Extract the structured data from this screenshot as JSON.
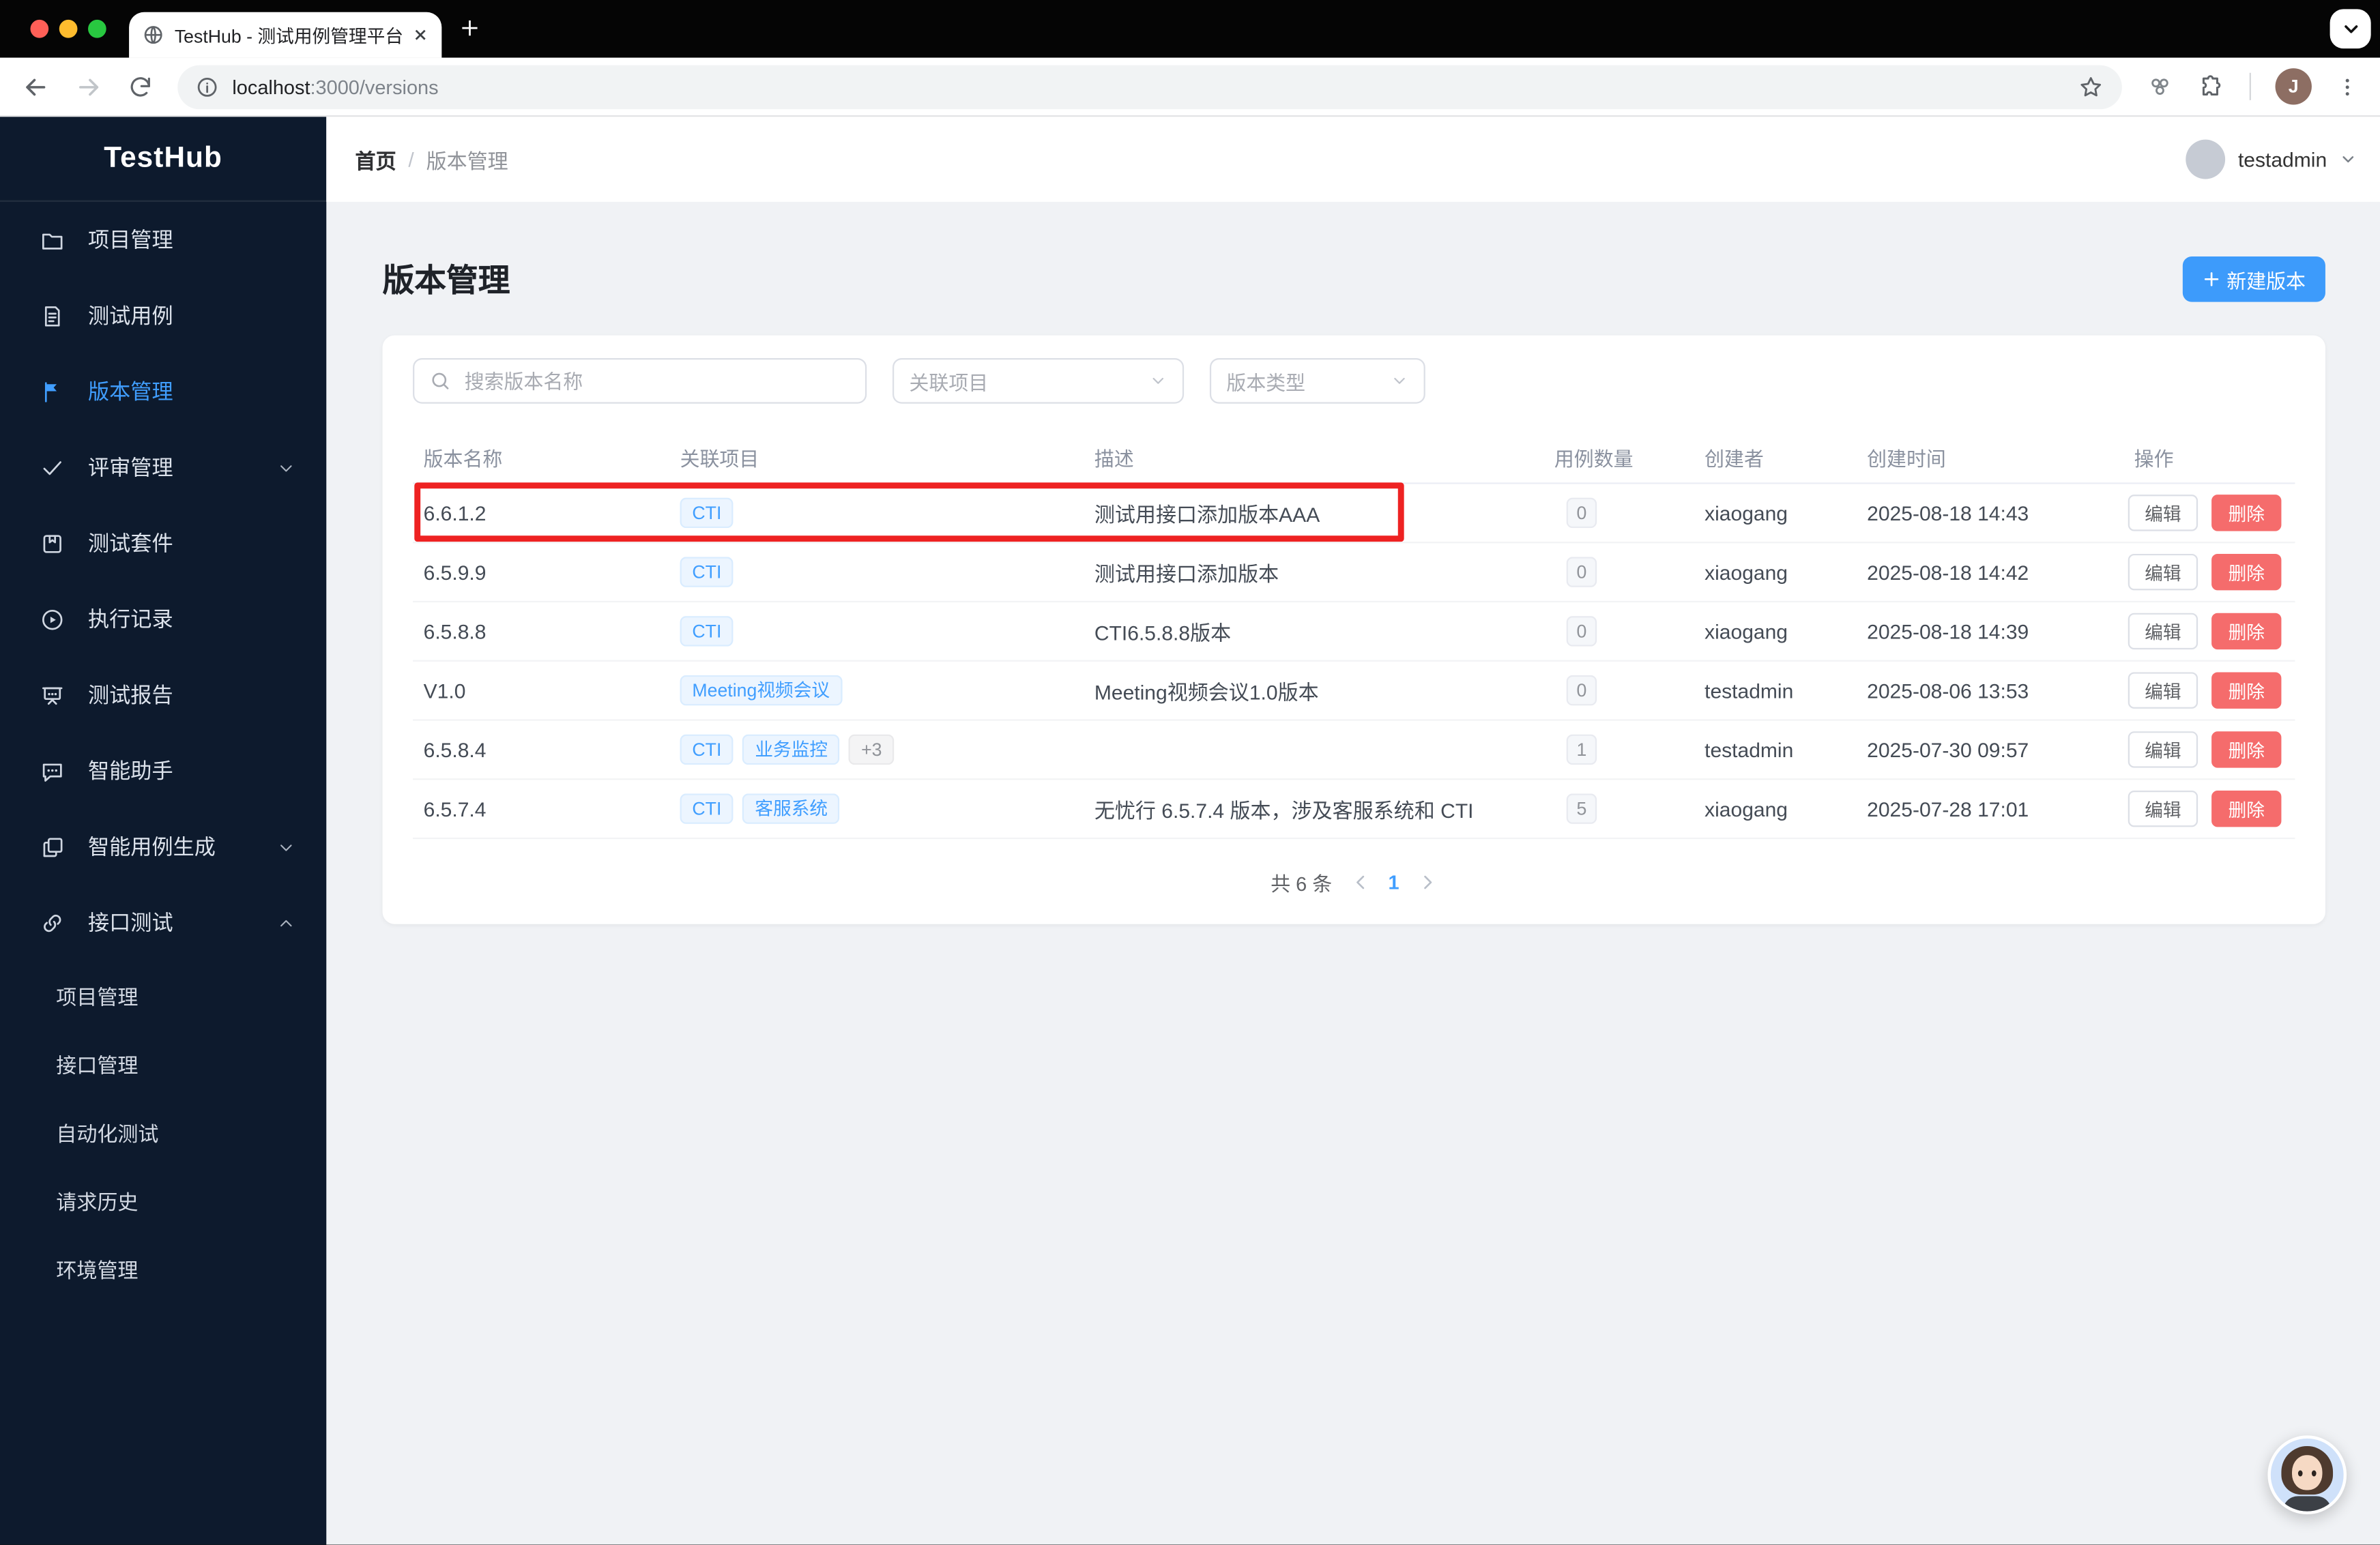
{
  "browser": {
    "tab_title": "TestHub - 测试用例管理平台",
    "url_host": "localhost",
    "url_rest": ":3000/versions"
  },
  "sidebar": {
    "logo": "TestHub",
    "items": [
      {
        "label": "项目管理",
        "icon": "folder-icon",
        "active": false,
        "chevron": null
      },
      {
        "label": "测试用例",
        "icon": "document-icon",
        "active": false,
        "chevron": null
      },
      {
        "label": "版本管理",
        "icon": "flag-icon",
        "active": true,
        "chevron": null
      },
      {
        "label": "评审管理",
        "icon": "check-icon",
        "active": false,
        "chevron": "down"
      },
      {
        "label": "测试套件",
        "icon": "bookmark-icon",
        "active": false,
        "chevron": null
      },
      {
        "label": "执行记录",
        "icon": "play-circle-icon",
        "active": false,
        "chevron": null
      },
      {
        "label": "测试报告",
        "icon": "presentation-icon",
        "active": false,
        "chevron": null
      },
      {
        "label": "智能助手",
        "icon": "chat-icon",
        "active": false,
        "chevron": null
      },
      {
        "label": "智能用例生成",
        "icon": "copy-icon",
        "active": false,
        "chevron": "down"
      },
      {
        "label": "接口测试",
        "icon": "link-icon",
        "active": false,
        "chevron": "up"
      }
    ],
    "sub_items": [
      "项目管理",
      "接口管理",
      "自动化测试",
      "请求历史",
      "环境管理"
    ]
  },
  "header": {
    "breadcrumb_home": "首页",
    "breadcrumb_sep": "/",
    "breadcrumb_current": "版本管理",
    "user_name": "testadmin"
  },
  "page": {
    "title": "版本管理",
    "new_button_label": "新建版本",
    "search_placeholder": "搜索版本名称",
    "filter_project_placeholder": "关联项目",
    "filter_type_placeholder": "版本类型"
  },
  "table": {
    "headers": [
      "版本名称",
      "关联项目",
      "描述",
      "用例数量",
      "创建者",
      "创建时间",
      "操作"
    ],
    "edit_label": "编辑",
    "delete_label": "删除",
    "rows": [
      {
        "name": "6.6.1.2",
        "projects": [
          "CTI"
        ],
        "extra": null,
        "desc": "测试用接口添加版本AAA",
        "count": "0",
        "creator": "xiaogang",
        "time": "2025-08-18 14:43",
        "highlighted": true
      },
      {
        "name": "6.5.9.9",
        "projects": [
          "CTI"
        ],
        "extra": null,
        "desc": "测试用接口添加版本",
        "count": "0",
        "creator": "xiaogang",
        "time": "2025-08-18 14:42",
        "highlighted": false
      },
      {
        "name": "6.5.8.8",
        "projects": [
          "CTI"
        ],
        "extra": null,
        "desc": "CTI6.5.8.8版本",
        "count": "0",
        "creator": "xiaogang",
        "time": "2025-08-18 14:39",
        "highlighted": false
      },
      {
        "name": "V1.0",
        "projects": [
          "Meeting视频会议"
        ],
        "extra": null,
        "desc": "Meeting视频会议1.0版本",
        "count": "0",
        "creator": "testadmin",
        "time": "2025-08-06 13:53",
        "highlighted": false
      },
      {
        "name": "6.5.8.4",
        "projects": [
          "CTI",
          "业务监控"
        ],
        "extra": "+3",
        "desc": "",
        "count": "1",
        "creator": "testadmin",
        "time": "2025-07-30 09:57",
        "highlighted": false
      },
      {
        "name": "6.5.7.4",
        "projects": [
          "CTI",
          "客服系统"
        ],
        "extra": null,
        "desc": "无忧行 6.5.7.4 版本，涉及客服系统和 CTI",
        "count": "5",
        "creator": "xiaogang",
        "time": "2025-07-28 17:01",
        "highlighted": false
      }
    ],
    "pagination": {
      "total": "共 6 条",
      "page": "1"
    }
  },
  "colors": {
    "accent_blue": "#409eff",
    "danger_red": "#f56c6c",
    "highlight_border": "#ee2222",
    "sidebar_bg": "#0d1a2d",
    "content_bg": "#f0f2f5",
    "traffic_red": "#ff5f57",
    "traffic_yellow": "#febc2e",
    "traffic_green": "#28c840"
  }
}
